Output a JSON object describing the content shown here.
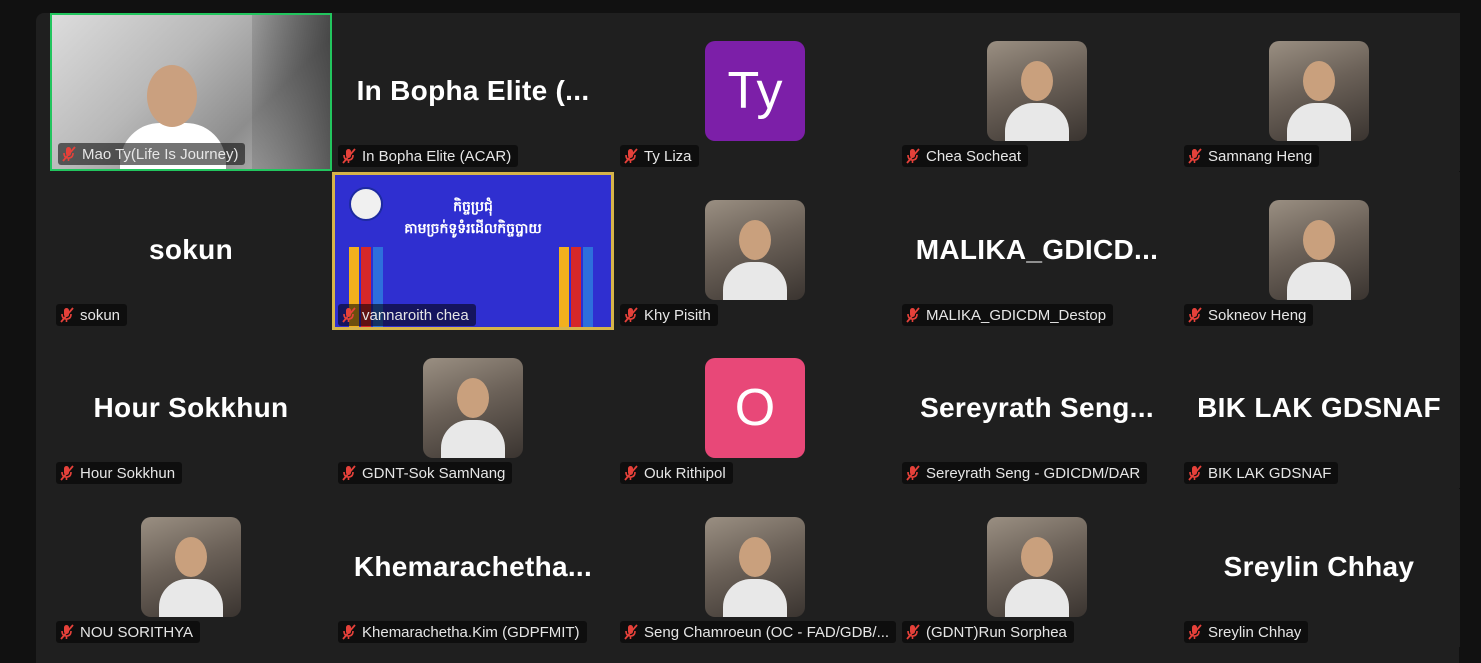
{
  "participants": [
    {
      "id": "p1",
      "label": "Mao Ty(Life Is Journey)",
      "display": "video",
      "active": true
    },
    {
      "id": "p2",
      "label": "In Bopha Elite (ACAR)",
      "display": "name",
      "big_name": "In Bopha Elite (..."
    },
    {
      "id": "p3",
      "label": "Ty Liza",
      "display": "initials",
      "initials": "Ty",
      "color": "#7c1fa8"
    },
    {
      "id": "p4",
      "label": "Chea Socheat",
      "display": "photo"
    },
    {
      "id": "p5",
      "label": "Samnang Heng",
      "display": "photo"
    },
    {
      "id": "p6",
      "label": "sokun",
      "display": "name",
      "big_name": "sokun"
    },
    {
      "id": "p7",
      "label": "vannaroith chea",
      "display": "banner",
      "banner_text": "កិច្ចប្រជុំ\nគាមច្រក់ទូទំរដើលកិច្ចប្ចាយ"
    },
    {
      "id": "p8",
      "label": "Khy Pisith",
      "display": "photo"
    },
    {
      "id": "p9",
      "label": "MALIKA_GDICDM_Destop",
      "display": "name",
      "big_name": "MALIKA_GDICD..."
    },
    {
      "id": "p10",
      "label": "Sokneov Heng",
      "display": "photo"
    },
    {
      "id": "p11",
      "label": "Hour Sokkhun",
      "display": "name",
      "big_name": "Hour Sokkhun"
    },
    {
      "id": "p12",
      "label": "GDNT-Sok SamNang",
      "display": "photo"
    },
    {
      "id": "p13",
      "label": "Ouk Rithipol",
      "display": "initials",
      "initials": "O",
      "color": "#e84878"
    },
    {
      "id": "p14",
      "label": "Sereyrath Seng - GDICDM/DAR",
      "display": "name",
      "big_name": "Sereyrath  Seng..."
    },
    {
      "id": "p15",
      "label": "BIK LAK GDSNAF",
      "display": "name",
      "big_name": "BIK LAK GDSNAF"
    },
    {
      "id": "p16",
      "label": "NOU SORITHYA",
      "display": "photo"
    },
    {
      "id": "p17",
      "label": "Khemarachetha.Kim (GDPFMIT)",
      "display": "name",
      "big_name": "Khemarachetha..."
    },
    {
      "id": "p18",
      "label": "Seng Chamroeun (OC - FAD/GDB/...",
      "display": "photo"
    },
    {
      "id": "p19",
      "label": "(GDNT)Run Sorphea",
      "display": "photo"
    },
    {
      "id": "p20",
      "label": "Sreylin Chhay",
      "display": "name",
      "big_name": "Sreylin Chhay"
    }
  ],
  "icons": {
    "muted": "mic-muted-icon"
  },
  "colors": {
    "active_border": "#22c55e",
    "muted_icon": "#e5413a",
    "tile_bg": "#1f1f1f"
  }
}
